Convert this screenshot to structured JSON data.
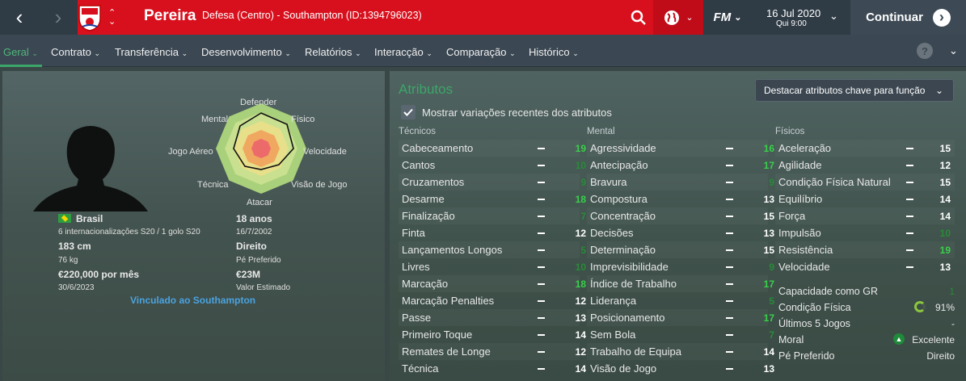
{
  "header": {
    "player_name": "Pereira",
    "subtitle": "Defesa (Centro) - Southampton (ID:1394796023)",
    "fm_label": "FM",
    "date": "16 Jul 2020",
    "time": "Qui 9:00",
    "continue_label": "Continuar"
  },
  "tabs": [
    {
      "label": "Geral"
    },
    {
      "label": "Contrato"
    },
    {
      "label": "Transferência"
    },
    {
      "label": "Desenvolvimento"
    },
    {
      "label": "Relatórios"
    },
    {
      "label": "Interacção"
    },
    {
      "label": "Comparação"
    },
    {
      "label": "Histórico"
    }
  ],
  "help_label": "?",
  "radar": {
    "labels": [
      "Defender",
      "Físico",
      "Velocidade",
      "Visão de Jogo",
      "Atacar",
      "Técnica",
      "Jogo Aéreo",
      "Mental"
    ]
  },
  "profile": {
    "nationality": "Brasil",
    "caps": "6 internacionalizações S20 / 1 golo S20",
    "height": "183 cm",
    "weight": "76 kg",
    "wage": "€220,000 por mês",
    "contract_end": "30/6/2023",
    "age": "18 anos",
    "dob": "16/7/2002",
    "foot": "Direito",
    "foot_label": "Pé Preferido",
    "value": "€23M",
    "value_label": "Valor Estimado",
    "linked": "Vinculado ao Southampton"
  },
  "attributes": {
    "title": "Atributos",
    "highlight_button": "Destacar atributos chave para função",
    "show_changes": "Mostrar variações recentes dos atributos",
    "technical_header": "Técnicos",
    "mental_header": "Mental",
    "physical_header": "Físicos",
    "technical": [
      {
        "name": "Cabeceamento",
        "value": "19"
      },
      {
        "name": "Cantos",
        "value": "10"
      },
      {
        "name": "Cruzamentos",
        "value": "9"
      },
      {
        "name": "Desarme",
        "value": "18"
      },
      {
        "name": "Finalização",
        "value": "7"
      },
      {
        "name": "Finta",
        "value": "12"
      },
      {
        "name": "Lançamentos Longos",
        "value": "5"
      },
      {
        "name": "Livres",
        "value": "10"
      },
      {
        "name": "Marcação",
        "value": "18"
      },
      {
        "name": "Marcação Penalties",
        "value": "12"
      },
      {
        "name": "Passe",
        "value": "13"
      },
      {
        "name": "Primeiro Toque",
        "value": "14"
      },
      {
        "name": "Remates de Longe",
        "value": "12"
      },
      {
        "name": "Técnica",
        "value": "14"
      }
    ],
    "mental": [
      {
        "name": "Agressividade",
        "value": "16"
      },
      {
        "name": "Antecipação",
        "value": "17"
      },
      {
        "name": "Bravura",
        "value": "9"
      },
      {
        "name": "Compostura",
        "value": "13"
      },
      {
        "name": "Concentração",
        "value": "15"
      },
      {
        "name": "Decisões",
        "value": "13"
      },
      {
        "name": "Determinação",
        "value": "15"
      },
      {
        "name": "Imprevisibilidade",
        "value": "9"
      },
      {
        "name": "Índice de Trabalho",
        "value": "17"
      },
      {
        "name": "Liderança",
        "value": "5"
      },
      {
        "name": "Posicionamento",
        "value": "17"
      },
      {
        "name": "Sem Bola",
        "value": "7"
      },
      {
        "name": "Trabalho de Equipa",
        "value": "14"
      },
      {
        "name": "Visão de Jogo",
        "value": "13"
      }
    ],
    "physical": [
      {
        "name": "Aceleração",
        "value": "15"
      },
      {
        "name": "Agilidade",
        "value": "12"
      },
      {
        "name": "Condição Física Natural",
        "value": "15"
      },
      {
        "name": "Equilíbrio",
        "value": "14"
      },
      {
        "name": "Força",
        "value": "14"
      },
      {
        "name": "Impulsão",
        "value": "10"
      },
      {
        "name": "Resistência",
        "value": "19"
      },
      {
        "name": "Velocidade",
        "value": "13"
      }
    ]
  },
  "extra": [
    {
      "name": "Capacidade como GR",
      "value": "1"
    },
    {
      "name": "Condição Física",
      "value": "91%"
    },
    {
      "name": "Últimos 5 Jogos",
      "value": "-"
    },
    {
      "name": "Moral",
      "value": "Excelente"
    },
    {
      "name": "Pé Preferido",
      "value": "Direito"
    }
  ],
  "colors": {
    "brand_red": "#d8101d",
    "high": "#39d04a",
    "low": "#2a8a3a",
    "accent": "#3ca66a"
  }
}
